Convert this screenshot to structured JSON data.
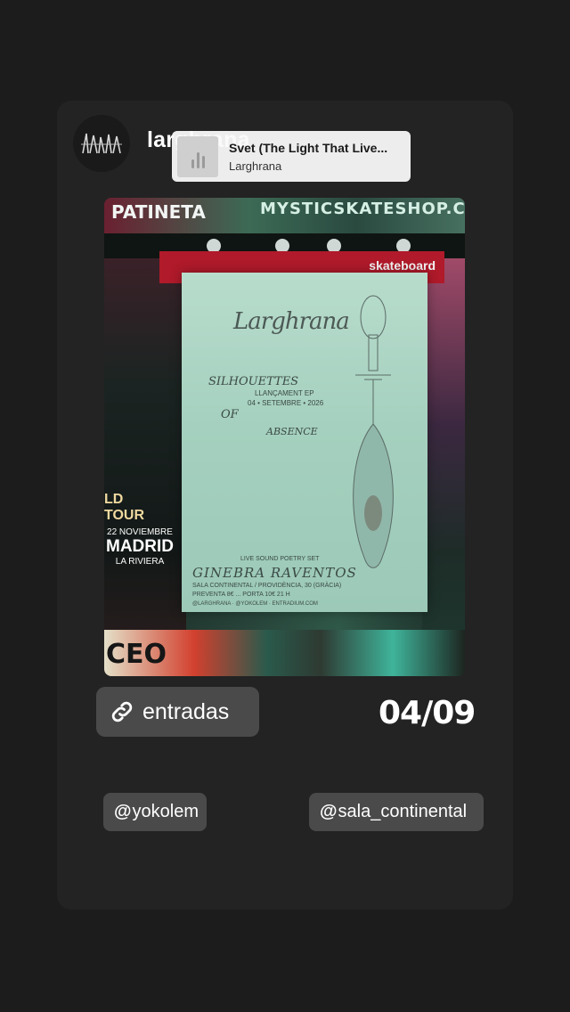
{
  "story": {
    "username": "larghrana",
    "avatar_icon": "larghrana-logo-icon"
  },
  "music": {
    "title": "Svet (The Light That Live...",
    "artist": "Larghrana",
    "icon": "music-bars-icon"
  },
  "photo": {
    "top_sticker_left": "PATINETA",
    "top_sticker_right": "MYSTICSKATESHOP.CZ",
    "red_sticker": "skateboard",
    "tour_text": "LD TOUR",
    "concert_date": "22 NOVIEMBRE",
    "concert_city": "MADRID",
    "concert_venue": "LA RIVIERA",
    "bottom_sticker": "CEO",
    "poster": {
      "logo": "Larghrana",
      "line1": "SILHOUETTES",
      "line2": "LLANÇAMENT EP",
      "line3": "04 • SETEMBRE • 2026",
      "line4": "OF",
      "line5": "ABSENCE",
      "line6": "LIVE SOUND POETRY SET",
      "line7": "GINEBRA RAVENTOS",
      "line8": "SALA CONTINENTAL      / PROVIDÈNCIA, 30 (GRÀCIA)",
      "line9": "PREVENTA 8€ ... PORTA 10€                    21 H",
      "line10": "@LARGHRANA · @YOKOLEM · ENTRADIUM.COM"
    }
  },
  "link_sticker": {
    "label": "entradas",
    "icon": "link-icon"
  },
  "date_text": "04/09",
  "mentions": [
    {
      "handle": "yokolem"
    },
    {
      "handle": "sala_continental"
    }
  ],
  "mention_symbol": "@"
}
